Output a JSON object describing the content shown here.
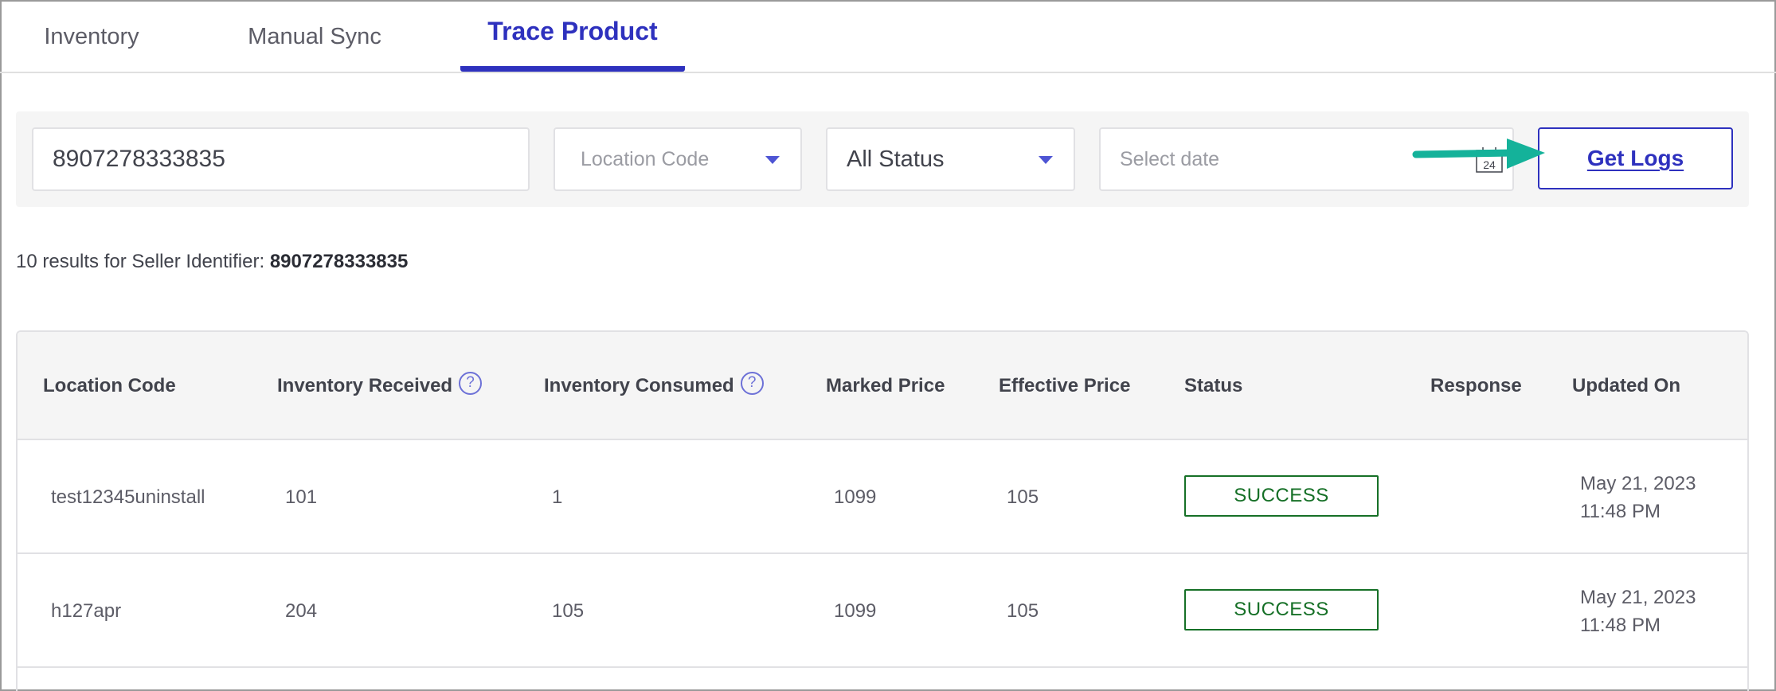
{
  "tabs": [
    {
      "label": "Inventory",
      "active": false
    },
    {
      "label": "Manual Sync",
      "active": false
    },
    {
      "label": "Trace Product",
      "active": true
    }
  ],
  "filters": {
    "search_value": "8907278333835",
    "location_placeholder": "Location Code",
    "status_value": "All Status",
    "date_placeholder": "Select date",
    "calendar_day": "24",
    "get_logs_label": "Get Logs"
  },
  "results": {
    "prefix": "10 results for Seller Identifier:",
    "identifier": "8907278333835"
  },
  "table": {
    "headers": {
      "location_code": "Location Code",
      "inventory_received": "Inventory Received",
      "inventory_consumed": "Inventory Consumed",
      "marked_price": "Marked Price",
      "effective_price": "Effective Price",
      "status": "Status",
      "response": "Response",
      "updated_on": "Updated On"
    },
    "help_glyph": "?",
    "rows": [
      {
        "location_code": "test12345uninstall",
        "inventory_received": "101",
        "inventory_consumed": "1",
        "marked_price": "1099",
        "effective_price": "105",
        "status": "SUCCESS",
        "response": "",
        "updated_date": "May 21, 2023",
        "updated_time": "11:48 PM"
      },
      {
        "location_code": "h127apr",
        "inventory_received": "204",
        "inventory_consumed": "105",
        "marked_price": "1099",
        "effective_price": "105",
        "status": "SUCCESS",
        "response": "",
        "updated_date": "May 21, 2023",
        "updated_time": "11:48 PM"
      }
    ]
  },
  "colors": {
    "accent": "#2e31be",
    "success": "#167027",
    "annotation_arrow": "#14b29a"
  }
}
